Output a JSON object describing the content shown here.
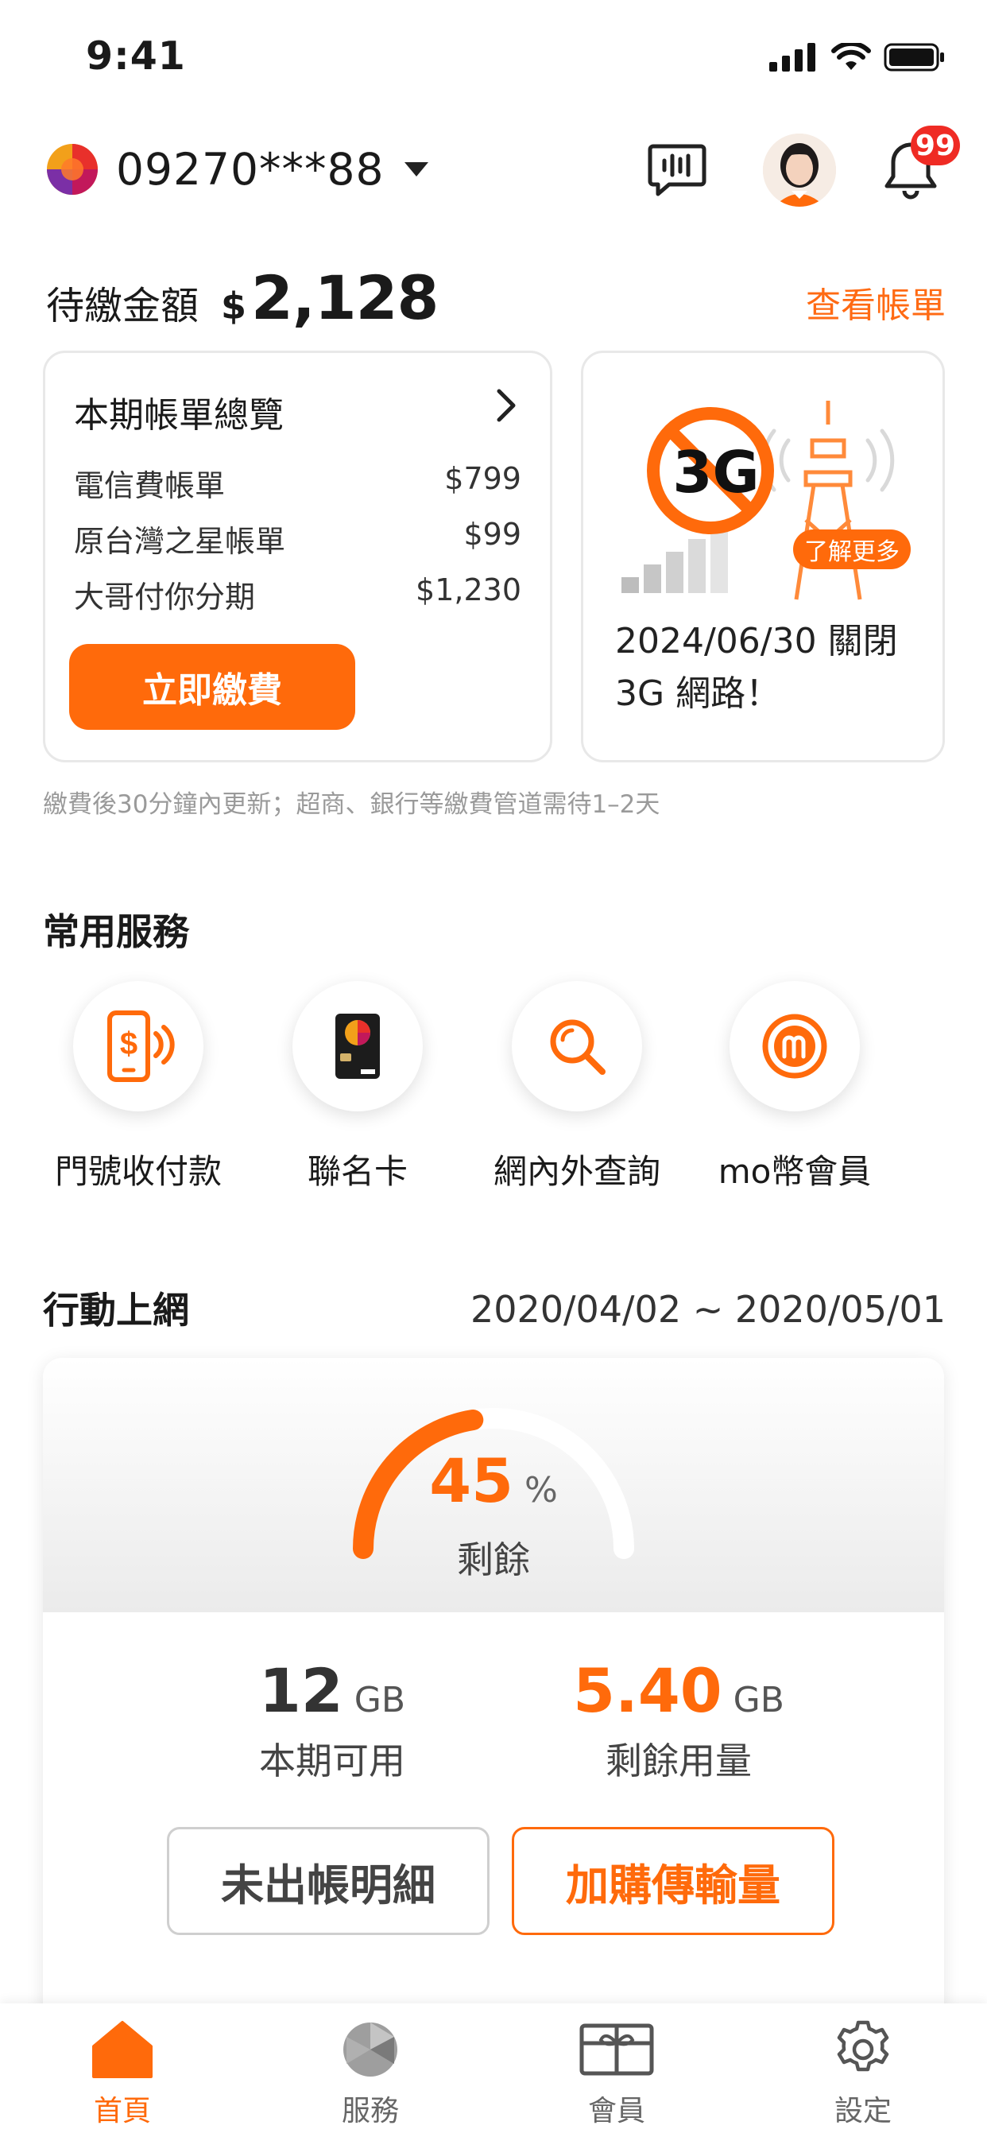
{
  "status_bar": {
    "time": "9:41"
  },
  "header": {
    "account_number": "09270***88",
    "notification_count": "99"
  },
  "billing": {
    "due_label": "待繳金額",
    "currency": "$",
    "due_amount": "2,128",
    "view_bill": "查看帳單",
    "summary_title": "本期帳單總覽",
    "items": [
      {
        "label": "電信費帳單",
        "amount": "$799"
      },
      {
        "label": "原台灣之星帳單",
        "amount": "$99"
      },
      {
        "label": "大哥付你分期",
        "amount": "$1,230"
      }
    ],
    "pay_button": "立即繳費",
    "note": "繳費後30分鐘內更新；超商、銀行等繳費管道需待1–2天"
  },
  "promo": {
    "badge_text": "3G",
    "learn_more": "了解更多",
    "line1": "2024/06/30 關閉",
    "line2": "3G 網路！"
  },
  "services": {
    "title": "常用服務",
    "items": [
      {
        "label": "門號收付款",
        "icon": "phone-payment-icon"
      },
      {
        "label": "聯名卡",
        "icon": "cobrand-card-icon"
      },
      {
        "label": "網內外查詢",
        "icon": "search-icon"
      },
      {
        "label": "mo幣會員",
        "icon": "mo-coin-icon"
      }
    ]
  },
  "mobile_data": {
    "title": "行動上網",
    "period": "2020/04/02 ~ 2020/05/01",
    "remaining_percent": 45,
    "percent_value": "45",
    "percent_unit": "%",
    "remaining_label": "剩餘",
    "available_value": "12",
    "available_unit": "GB",
    "available_label": "本期可用",
    "remaining_value": "5.40",
    "remaining_unit": "GB",
    "remaining_amount_label": "剩餘用量",
    "unbilled_button": "未出帳明細",
    "addon_button": "加購傳輸量"
  },
  "tabs": [
    {
      "label": "首頁",
      "icon": "home-icon",
      "active": true
    },
    {
      "label": "服務",
      "icon": "service-icon",
      "active": false
    },
    {
      "label": "會員",
      "icon": "member-card-icon",
      "active": false
    },
    {
      "label": "設定",
      "icon": "gear-icon",
      "active": false
    }
  ],
  "colors": {
    "accent": "#ff6a0b",
    "badge": "#ef2b24",
    "text": "#1a1a1a",
    "muted": "#9a9a9a"
  }
}
